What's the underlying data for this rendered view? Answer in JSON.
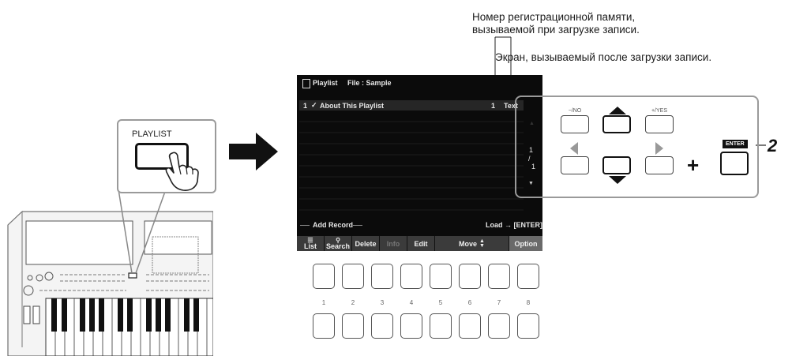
{
  "callouts": {
    "registration_line1": "Номер регистрационной памяти,",
    "registration_line2": "вызываемой при загрузке записи.",
    "screen_after_load": "Экран, вызываемый после загрузки записи."
  },
  "step_number": "2",
  "panel": {
    "playlist_button_label": "PLAYLIST"
  },
  "screen": {
    "header_title": "Playlist",
    "header_file": "File : Sample",
    "record": {
      "index": "1",
      "check": "✓",
      "title": "About This Playlist",
      "reg_number": "1",
      "screen": "Text"
    },
    "page_current": "1",
    "page_sep": "/",
    "page_total": "1",
    "add_record": "Add Record",
    "load_hint": "Load → [ENTER]",
    "buttons": {
      "list": "List",
      "search": "Search",
      "delete": "Delete",
      "info": "Info",
      "edit": "Edit",
      "move": "Move",
      "option": "Option"
    }
  },
  "control_panel": {
    "no_label": "−/NO",
    "yes_label": "+/YES",
    "enter_label": "ENTER",
    "plus": "+"
  },
  "panel_numbers": [
    "1",
    "2",
    "3",
    "4",
    "5",
    "6",
    "7",
    "8"
  ]
}
